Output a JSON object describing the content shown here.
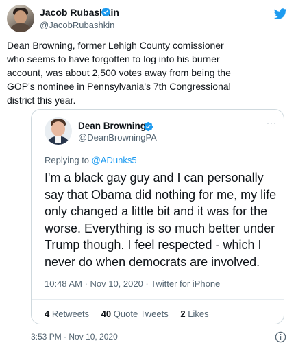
{
  "tweet": {
    "author": {
      "name": "Jacob Rubashkin",
      "handle": "@JacobRubashkin"
    },
    "text_lines": [
      "Dean Browning, former Lehigh County comissioner",
      "who seems to have forgotten to log into his burner",
      "account, was about 2,500 votes away from being the",
      "GOP's nominee in Pennsylvania's 7th Congressional",
      "district this year."
    ],
    "timestamp": "3:53 PM · Nov 10, 2020"
  },
  "quote": {
    "author": {
      "name": "Dean Browning",
      "handle": "@DeanBrowningPA"
    },
    "more": "···",
    "replying_prefix": "Replying to ",
    "replying_mention": "@ADunks5",
    "text_lines": [
      "I'm a black gay guy and I can personally",
      "say that Obama did nothing for me, my life",
      "only changed a little bit and it was for the",
      "worse. Everything is so much better under",
      "Trump though. I feel respected - which I",
      "never do when democrats are involved."
    ],
    "meta": "10:48 AM · Nov 10, 2020 · Twitter for iPhone",
    "stats": {
      "retweets_count": "4",
      "retweets_label": "Retweets",
      "quotes_count": "40",
      "quotes_label": "Quote Tweets",
      "likes_count": "2",
      "likes_label": "Likes"
    }
  },
  "colors": {
    "twitter_blue": "#1d9bf0",
    "verified_blue": "#1d9bf0",
    "text_primary": "#0f1419",
    "text_secondary": "#536471",
    "card_border": "#cfd9de"
  },
  "icons": {
    "verified": "verified-badge-icon",
    "logo": "twitter-bird-icon",
    "more": "more-dots-icon",
    "info": "info-icon"
  }
}
